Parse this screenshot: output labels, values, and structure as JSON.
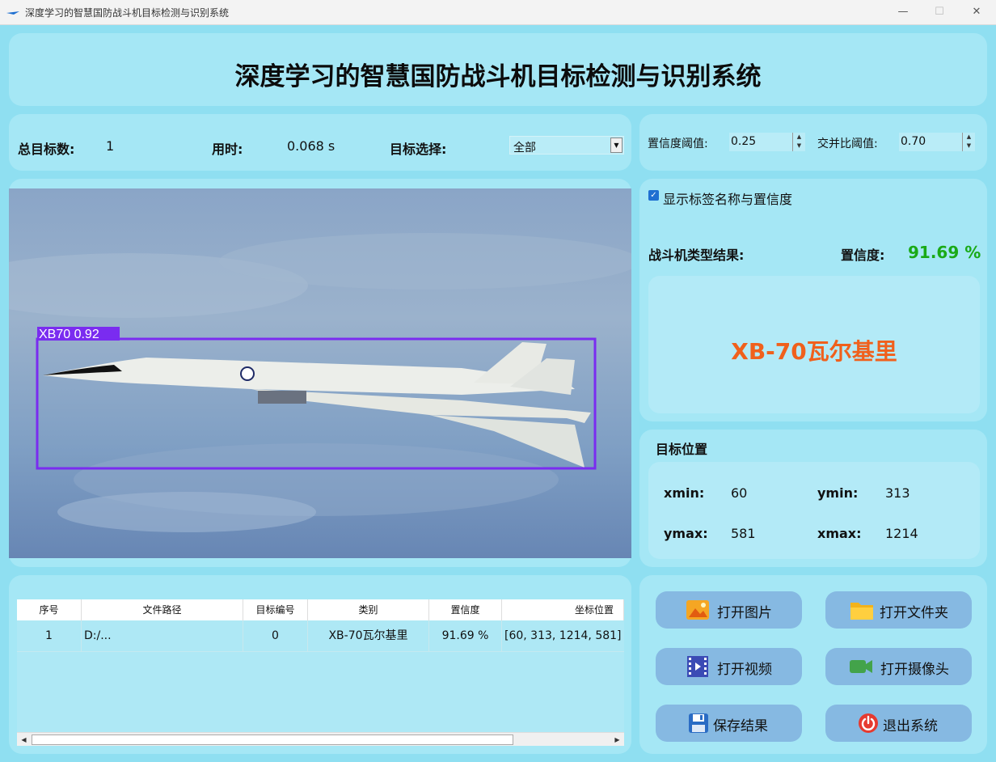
{
  "window": {
    "title": "深度学习的智慧国防战斗机目标检测与识别系统"
  },
  "header": {
    "title": "深度学习的智慧国防战斗机目标检测与识别系统"
  },
  "stats": {
    "total_label": "总目标数:",
    "total_value": "1",
    "time_label": "用时:",
    "time_value": "0.068 s",
    "select_label": "目标选择:",
    "select_value": "全部"
  },
  "params": {
    "conf_label": "置信度阈值:",
    "conf_value": "0.25",
    "iou_label": "交并比阈值:",
    "iou_value": "0.70"
  },
  "detection": {
    "box_label": "XB70  0.92"
  },
  "result": {
    "show_label_text": "显示标签名称与置信度",
    "show_label_checked": true,
    "type_label": "战斗机类型结果:",
    "conf_label": "置信度:",
    "conf_value": "91.69 %",
    "class_name": "XB-70瓦尔基里"
  },
  "position": {
    "title": "目标位置",
    "xmin_label": "xmin:",
    "xmin": "60",
    "ymin_label": "ymin:",
    "ymin": "313",
    "ymax_label": "ymax:",
    "ymax": "581",
    "xmax_label": "xmax:",
    "xmax": "1214"
  },
  "table": {
    "headers": [
      "序号",
      "文件路径",
      "目标编号",
      "类别",
      "置信度",
      "坐标位置"
    ],
    "rows": [
      [
        "1",
        "D:/...",
        "0",
        "XB-70瓦尔基里",
        "91.69 %",
        "[60, 313, 1214, 581]"
      ]
    ]
  },
  "buttons": {
    "open_image": "打开图片",
    "open_folder": "打开文件夹",
    "open_video": "打开视频",
    "open_camera": "打开摄像头",
    "save_result": "保存结果",
    "exit": "退出系统"
  },
  "colors": {
    "accent_green": "#1aaa17",
    "class_orange": "#f0601c",
    "box_purple": "#7a2cf0"
  }
}
